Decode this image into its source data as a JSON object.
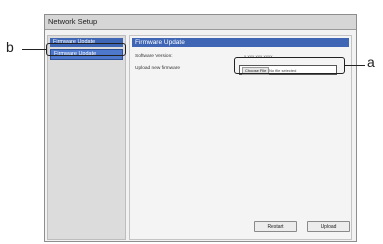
{
  "window": {
    "title": "Network Setup"
  },
  "sidebar": {
    "items": [
      {
        "label": "Firmware Update"
      },
      {
        "label": "Firmware Update"
      }
    ]
  },
  "content": {
    "header": "Firmware Update",
    "software_version_label": "Software Version:",
    "software_version_value": "x.xxx.xxx.xxxx",
    "upload_label": "Upload new firmware",
    "choose_file_label": "Choose File",
    "no_file_text": "No file selected"
  },
  "buttons": {
    "restart": "Restart",
    "upload": "Upload"
  },
  "callouts": {
    "a": "a",
    "b": "b"
  },
  "colors": {
    "accent": "#3f66b5",
    "active_item": "#4d78cc",
    "window_bg": "#f2f2f2"
  }
}
